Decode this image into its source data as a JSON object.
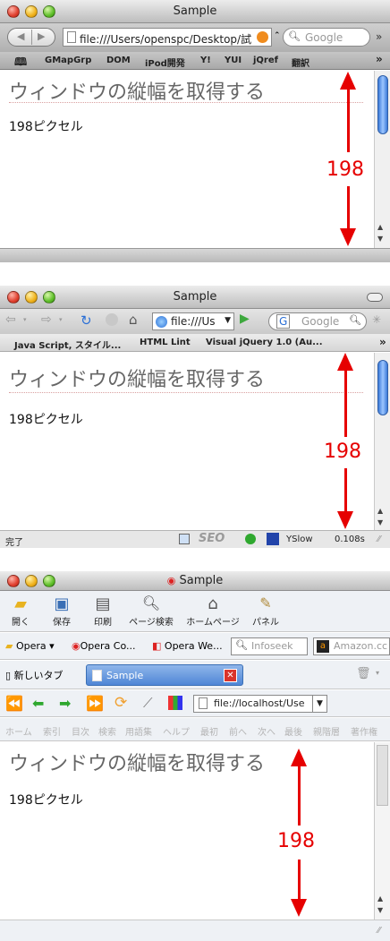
{
  "safari": {
    "title": "Sample",
    "url": "file:///Users/openspc/Desktop/試",
    "search_placeholder": "Google",
    "bookmarks": [
      "GMapGrp",
      "DOM",
      "iPod開発",
      "Y!",
      "YUI",
      "jQref",
      "翻訳"
    ],
    "heading": "ウィンドウの縦幅を取得する",
    "result": "198ピクセル",
    "measure_label": "198"
  },
  "firefox": {
    "title": "Sample",
    "url": "file:///Us",
    "search_placeholder": "Google",
    "bookmarks": [
      "Java Script, スタイル...",
      "HTML Lint",
      "Visual jQuery 1.0 (Au..."
    ],
    "heading": "ウィンドウの縦幅を取得する",
    "result": "198ピクセル",
    "measure_label": "198",
    "status_left": "完了",
    "yslow": "YSlow",
    "load_time": "0.108s"
  },
  "opera": {
    "title": "Sample",
    "toolbar": [
      "開く",
      "保存",
      "印刷",
      "ページ検索",
      "ホームページ",
      "パネル"
    ],
    "personal_bar": [
      "Opera",
      "Opera Co...",
      "Opera We..."
    ],
    "infoseek": "Infoseek",
    "amazon": "Amazon.cc",
    "new_tab": "新しいタブ",
    "active_tab": "Sample",
    "url": "file://localhost/Use",
    "nav_links": [
      "ホーム",
      "索引",
      "目次",
      "検索",
      "用語集",
      "ヘルプ",
      "最初",
      "前へ",
      "次へ",
      "最後",
      "親階層",
      "著作権"
    ],
    "heading": "ウィンドウの縦幅を取得する",
    "result": "198ピクセル",
    "measure_label": "198"
  }
}
